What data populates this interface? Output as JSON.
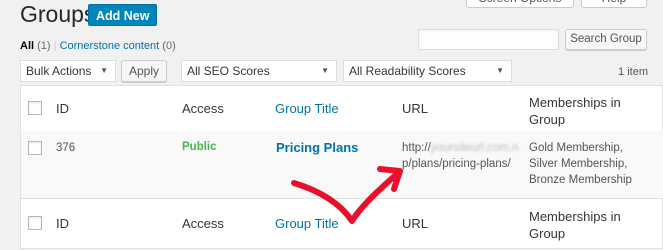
{
  "top_buttons": [
    "Screen Options",
    "Help"
  ],
  "header": {
    "title": "Groups",
    "add_new": "Add New"
  },
  "subsubsub": {
    "all_label": "All",
    "all_count": "(1)",
    "separator": "|",
    "cornerstone_label": "Cornerstone content",
    "cornerstone_count": "(0)"
  },
  "search": {
    "placeholder": "",
    "button": "Search Group"
  },
  "filters": {
    "bulk_actions": "Bulk Actions",
    "apply": "Apply",
    "seo_scores": "All SEO Scores",
    "readability_scores": "All Readability Scores",
    "item_count": "1 item"
  },
  "columns": {
    "id": "ID",
    "access": "Access",
    "group_title": "Group Title",
    "url": "URL",
    "memberships_line1": "Memberships in",
    "memberships_line2": "Group"
  },
  "rows": [
    {
      "id": "376",
      "access": "Public",
      "title": "Pricing Plans",
      "url_prefix": "http://",
      "url_blurred": "yoursiteurl.com.n",
      "url_line2": "p/plans/pricing-plans/",
      "memberships": [
        "Gold Membership,",
        "Silver Membership,",
        "Bronze Membership"
      ]
    }
  ],
  "colors": {
    "accent": "#0085ba",
    "link": "#0073aa",
    "public": "#46b450",
    "annotation_arrow": "#e8102a"
  },
  "icons": {
    "caret": "▼"
  }
}
